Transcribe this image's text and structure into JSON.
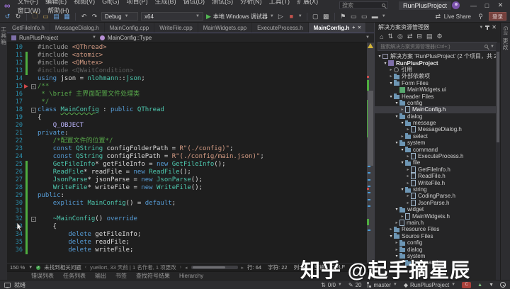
{
  "colors": {
    "accent": "#007acc",
    "chrome_bg": "#2d2d30",
    "editor_bg": "#1e1e1e",
    "panel_bg": "#252526",
    "change_tracking": "#4ead3f",
    "keyword": "#569cd6",
    "type": "#4ec9b0",
    "string": "#d69d85",
    "comment": "#57a64a",
    "macro": "#beb7ff",
    "line_number": "#2b91af",
    "selection": "#3c3c41",
    "watermark": "#ffffff"
  },
  "title_bar": {
    "menus": [
      "文件(F)",
      "编辑(E)",
      "视图(V)",
      "Git(G)",
      "项目(P)",
      "生成(B)",
      "调试(D)",
      "测试(S)",
      "分析(N)",
      "工具(T)",
      "扩展(X)",
      "窗口(W)",
      "帮助(H)"
    ],
    "search_placeholder": "搜索",
    "window_title": "RunPlusProject"
  },
  "toolbar": {
    "config": "Debug",
    "platform": "x64",
    "run_label": "本地 Windows 调试器",
    "liveshare_label": "Live Share",
    "signin_label": "登录"
  },
  "left_strip": {
    "label": "工具箱"
  },
  "right_strip": {
    "label": "Git 更改"
  },
  "tabs": [
    {
      "label": "GetFileInfo.h",
      "active": false
    },
    {
      "label": "MessageDialog.h",
      "active": false
    },
    {
      "label": "MainConfig.cpp",
      "active": false
    },
    {
      "label": "WriteFile.cpp",
      "active": false
    },
    {
      "label": "MainWidgets.cpp",
      "active": false
    },
    {
      "label": "ExecuteProcess.h",
      "active": false
    },
    {
      "label": "MainConfig.h",
      "active": true
    }
  ],
  "breadcrumb": {
    "project": "RunPlusProject",
    "scope": "MainConfig::Type"
  },
  "editor": {
    "lines": [
      {
        "n": 10,
        "segs": [
          [
            "pp",
            "#include "
          ],
          [
            "str",
            "<QThread>"
          ]
        ]
      },
      {
        "n": 11,
        "chg": true,
        "segs": [
          [
            "pp",
            "#include "
          ],
          [
            "str",
            "<atomic>"
          ]
        ]
      },
      {
        "n": 12,
        "chg": true,
        "segs": [
          [
            "pp",
            "#include "
          ],
          [
            "str",
            "<QMutex>"
          ]
        ]
      },
      {
        "n": 13,
        "chg": true,
        "segs": [
          [
            "dim",
            "#include <QWaitCondition>"
          ]
        ]
      },
      {
        "n": 14,
        "segs": [
          [
            "kw",
            "using"
          ],
          [
            "id",
            " json = "
          ],
          [
            "ty",
            "nlohmann"
          ],
          [
            "id",
            "::"
          ],
          [
            "ty",
            "json"
          ],
          [
            "id",
            ";"
          ]
        ]
      },
      {
        "n": 15,
        "fold": true,
        "marker": "red",
        "segs": [
          [
            "com",
            "/**"
          ]
        ]
      },
      {
        "n": 16,
        "segs": [
          [
            "com",
            " * \\brief 主界面配置文件处理类"
          ]
        ]
      },
      {
        "n": 17,
        "segs": [
          [
            "com",
            " */"
          ]
        ]
      },
      {
        "n": 18,
        "fold": true,
        "segs": [
          [
            "kw",
            "class "
          ],
          [
            "tyu",
            "MainConfig"
          ],
          [
            "id",
            " : "
          ],
          [
            "kw",
            "public "
          ],
          [
            "ty",
            "QThread"
          ]
        ]
      },
      {
        "n": 19,
        "segs": [
          [
            "id",
            "{"
          ]
        ]
      },
      {
        "n": 20,
        "segs": [
          [
            "id",
            "    "
          ],
          [
            "mac",
            "Q_OBJECT"
          ]
        ]
      },
      {
        "n": 21,
        "segs": [
          [
            "kw",
            "private"
          ],
          [
            "id",
            ":"
          ]
        ]
      },
      {
        "n": 22,
        "segs": [
          [
            "id",
            "    "
          ],
          [
            "com",
            "/*配置文件的位置*/"
          ]
        ]
      },
      {
        "n": 23,
        "segs": [
          [
            "id",
            "    "
          ],
          [
            "kw",
            "const "
          ],
          [
            "ty",
            "QString"
          ],
          [
            "id",
            " configFolderPath = "
          ],
          [
            "str",
            "R\"(./config)\""
          ],
          [
            "id",
            ";"
          ]
        ]
      },
      {
        "n": 24,
        "segs": [
          [
            "id",
            "    "
          ],
          [
            "kw",
            "const "
          ],
          [
            "ty",
            "QString"
          ],
          [
            "id",
            " configFilePath = "
          ],
          [
            "str",
            "R\"(./config/main.json)\""
          ],
          [
            "id",
            ";"
          ]
        ]
      },
      {
        "n": 25,
        "chg": true,
        "segs": [
          [
            "id",
            "    "
          ],
          [
            "ty",
            "GetFileInfo"
          ],
          [
            "id",
            "* getFileInfo = "
          ],
          [
            "kw",
            "new "
          ],
          [
            "ty",
            "GetFileInfo"
          ],
          [
            "id",
            "();"
          ]
        ]
      },
      {
        "n": 26,
        "chg": true,
        "segs": [
          [
            "id",
            "    "
          ],
          [
            "ty",
            "ReadFile"
          ],
          [
            "id",
            "* readFile = "
          ],
          [
            "kw",
            "new "
          ],
          [
            "ty",
            "ReadFile"
          ],
          [
            "id",
            "();"
          ]
        ]
      },
      {
        "n": 27,
        "chg": true,
        "segs": [
          [
            "id",
            "    "
          ],
          [
            "ty",
            "JsonParse"
          ],
          [
            "id",
            "* jsonParse = "
          ],
          [
            "kw",
            "new "
          ],
          [
            "ty",
            "JsonParse"
          ],
          [
            "id",
            "();"
          ]
        ]
      },
      {
        "n": 28,
        "chg": true,
        "segs": [
          [
            "id",
            "    "
          ],
          [
            "ty",
            "WriteFile"
          ],
          [
            "id",
            "* writeFile = "
          ],
          [
            "kw",
            "new "
          ],
          [
            "ty",
            "WriteFile"
          ],
          [
            "id",
            "();"
          ]
        ]
      },
      {
        "n": 29,
        "chg": true,
        "segs": [
          [
            "kw",
            "public"
          ],
          [
            "id",
            ":"
          ]
        ]
      },
      {
        "n": 30,
        "chg": true,
        "segs": [
          [
            "id",
            "    "
          ],
          [
            "kw",
            "explicit "
          ],
          [
            "ty",
            "MainConfig"
          ],
          [
            "id",
            "() = "
          ],
          [
            "kw",
            "default"
          ],
          [
            "id",
            ";"
          ]
        ]
      },
      {
        "n": 31,
        "chg": true,
        "segs": []
      },
      {
        "n": 32,
        "chg": true,
        "fold": true,
        "segs": [
          [
            "id",
            "    "
          ],
          [
            "ty",
            "~MainConfig"
          ],
          [
            "id",
            "() "
          ],
          [
            "kw",
            "override"
          ]
        ]
      },
      {
        "n": 33,
        "chg": true,
        "segs": [
          [
            "id",
            "    {"
          ]
        ]
      },
      {
        "n": 34,
        "chg": true,
        "segs": [
          [
            "id",
            "        "
          ],
          [
            "kw",
            "delete"
          ],
          [
            "id",
            " getFileInfo;"
          ]
        ]
      },
      {
        "n": 35,
        "chg": true,
        "segs": [
          [
            "id",
            "        "
          ],
          [
            "kw",
            "delete"
          ],
          [
            "id",
            " readFile;"
          ]
        ]
      },
      {
        "n": 36,
        "chg": true,
        "segs": [
          [
            "id",
            "        "
          ],
          [
            "kw",
            "delete"
          ],
          [
            "id",
            " writeFile;"
          ]
        ]
      }
    ]
  },
  "editor_bottom": {
    "zoom_level": "150 %",
    "health": "未找到相关问题",
    "gitlens": "yuellort, 33 天前 | 1 名作者, 1 项更改",
    "position": {
      "line": "行: 64",
      "chars": "字符: 22",
      "column": "列: 31",
      "spaces": "空格",
      "eol": "CRLF"
    }
  },
  "panel_tabs": [
    "错误列表",
    "任务列表",
    "输出",
    "书签",
    "查找符号结果",
    "Hierarchy"
  ],
  "solution_explorer": {
    "title": "解决方案资源管理器",
    "search_placeholder": "搜索解决方案资源管理器(Ctrl+;)",
    "tree": [
      {
        "d": 0,
        "a": "e",
        "i": "sln",
        "label": "解决方案 'RunPlusProject' (2 个项目，共 2 个)"
      },
      {
        "d": 1,
        "a": "e",
        "i": "proj",
        "label": "RunPlusProject",
        "bold": true
      },
      {
        "d": 2,
        "a": "c",
        "i": "ref",
        "label": "引用"
      },
      {
        "d": 2,
        "a": "c",
        "i": "folder",
        "label": "外部依赖项"
      },
      {
        "d": 2,
        "a": "e",
        "i": "folder",
        "label": "Form Files"
      },
      {
        "d": 3,
        "a": "",
        "i": "ui",
        "label": "MainWidgets.ui"
      },
      {
        "d": 2,
        "a": "e",
        "i": "folder",
        "label": "Header Files"
      },
      {
        "d": 3,
        "a": "e",
        "i": "folder",
        "label": "config"
      },
      {
        "d": 4,
        "a": "c",
        "i": "doc",
        "label": "MainConfig.h",
        "sel": true
      },
      {
        "d": 3,
        "a": "e",
        "i": "folder",
        "label": "dialog"
      },
      {
        "d": 4,
        "a": "e",
        "i": "folder",
        "label": "message"
      },
      {
        "d": 5,
        "a": "c",
        "i": "doc",
        "label": "MessageDialog.h"
      },
      {
        "d": 4,
        "a": "c",
        "i": "folder",
        "label": "select"
      },
      {
        "d": 3,
        "a": "e",
        "i": "folder",
        "label": "system"
      },
      {
        "d": 4,
        "a": "e",
        "i": "folder",
        "label": "command"
      },
      {
        "d": 5,
        "a": "c",
        "i": "doc",
        "label": "ExecuteProcess.h"
      },
      {
        "d": 4,
        "a": "e",
        "i": "folder",
        "label": "file"
      },
      {
        "d": 5,
        "a": "c",
        "i": "doc",
        "label": "GetFileInfo.h"
      },
      {
        "d": 5,
        "a": "c",
        "i": "doc",
        "label": "ReadFile.h"
      },
      {
        "d": 5,
        "a": "c",
        "i": "doc",
        "label": "WriteFile.h"
      },
      {
        "d": 4,
        "a": "e",
        "i": "folder",
        "label": "string"
      },
      {
        "d": 5,
        "a": "c",
        "i": "doc",
        "label": "CodingParse.h"
      },
      {
        "d": 5,
        "a": "c",
        "i": "doc",
        "label": "JsonParse.h"
      },
      {
        "d": 3,
        "a": "e",
        "i": "folder",
        "label": "widget"
      },
      {
        "d": 4,
        "a": "c",
        "i": "doc",
        "label": "MainWidgets.h"
      },
      {
        "d": 3,
        "a": "c",
        "i": "doc",
        "label": "main.h"
      },
      {
        "d": 2,
        "a": "c",
        "i": "folder",
        "label": "Resource Files"
      },
      {
        "d": 2,
        "a": "e",
        "i": "folder",
        "label": "Source Files"
      },
      {
        "d": 3,
        "a": "c",
        "i": "folder",
        "label": "config"
      },
      {
        "d": 3,
        "a": "c",
        "i": "folder",
        "label": "dialog"
      },
      {
        "d": 3,
        "a": "e",
        "i": "folder",
        "label": "system"
      },
      {
        "d": 4,
        "a": "e",
        "i": "folder",
        "label": "command"
      }
    ]
  },
  "status_bar": {
    "ready_label": "就绪",
    "sync_count": "0/0",
    "edit_count": "20",
    "branch": "master",
    "repository": "RunPlusProject"
  },
  "watermark": {
    "text": "知乎 @起手摘星辰"
  }
}
